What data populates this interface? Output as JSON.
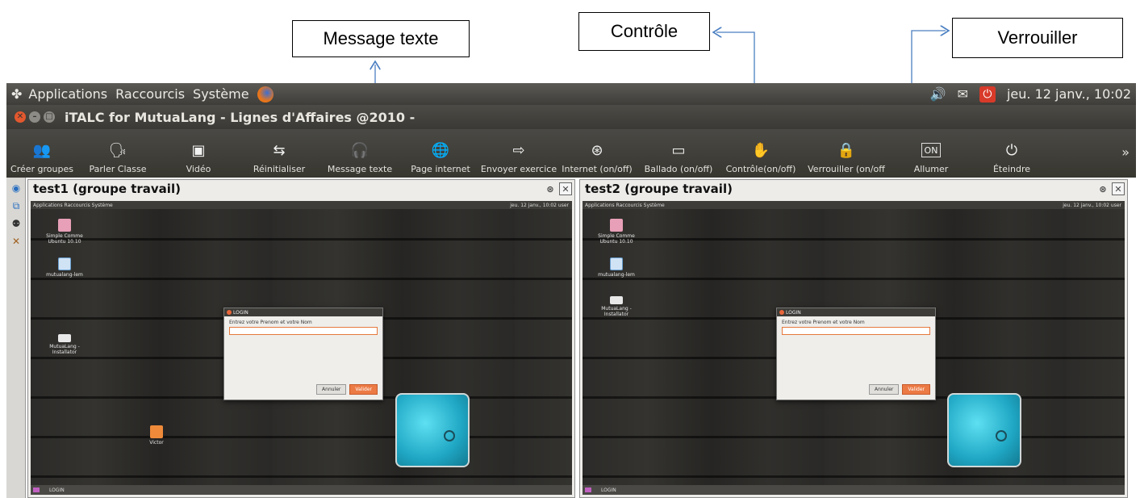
{
  "callouts": {
    "message": "Message texte",
    "controle": "Contrôle",
    "verrouiller": "Verrouiller"
  },
  "menubar": {
    "items": [
      "Applications",
      "Raccourcis",
      "Système"
    ],
    "datetime": "jeu. 12 janv., 10:02"
  },
  "window": {
    "title": "iTALC for MutuaLang - Lignes d'Affaires @2010 -"
  },
  "toolbar": {
    "items": [
      {
        "label": "Créer groupes",
        "icon": "users-icon"
      },
      {
        "label": "Parler Classe",
        "icon": "speaker-icon"
      },
      {
        "label": "Vidéo",
        "icon": "video-icon"
      },
      {
        "label": "Réinitialiser",
        "icon": "reset-icon"
      },
      {
        "label": "Message texte",
        "icon": "message-icon"
      },
      {
        "label": "Page internet",
        "icon": "globe-icon"
      },
      {
        "label": "Envoyer exercice",
        "icon": "send-icon"
      },
      {
        "label": "Internet (on/off)",
        "icon": "network-icon"
      },
      {
        "label": "Ballado (on/off)",
        "icon": "usb-icon"
      },
      {
        "label": "Contrôle(on/off)",
        "icon": "hand-icon"
      },
      {
        "label": "Verrouiller (on/off",
        "icon": "lock-icon"
      },
      {
        "label": "Allumer",
        "icon": "power-on-icon"
      },
      {
        "label": "Éteindre",
        "icon": "power-off-icon"
      }
    ],
    "more": "»"
  },
  "panels": [
    {
      "title": "test1 (groupe travail)",
      "mini_menu": "Applications  Raccourcis  Système",
      "mini_clock": "jeu. 12 janv., 10:02",
      "mini_user": "user",
      "icons": [
        "Simple Comme Ubuntu 10.10",
        "mutualang-lem",
        "MutuaLang - Installator",
        "Victor"
      ],
      "dialog": {
        "title": "LOGIN",
        "prompt": "Entrez votre Prenom et votre Nom",
        "cancel": "Annuler",
        "ok": "Valider"
      },
      "taskbar": "LOGIN"
    },
    {
      "title": "test2 (groupe travail)",
      "mini_menu": "Applications  Raccourcis  Système",
      "mini_clock": "jeu. 12 janv., 10:02",
      "mini_user": "user",
      "icons": [
        "Simple Comme Ubuntu 10.10",
        "mutualang-lem",
        "MutuaLang - Installator"
      ],
      "dialog": {
        "title": "LOGIN",
        "prompt": "Entrez votre Prenom et votre Nom",
        "cancel": "Annuler",
        "ok": "Valider"
      },
      "taskbar": "LOGIN"
    }
  ],
  "colors": {
    "panel_bg": "#2d2c2a",
    "accent": "#ec7a45",
    "arrow": "#4a7fc1"
  }
}
